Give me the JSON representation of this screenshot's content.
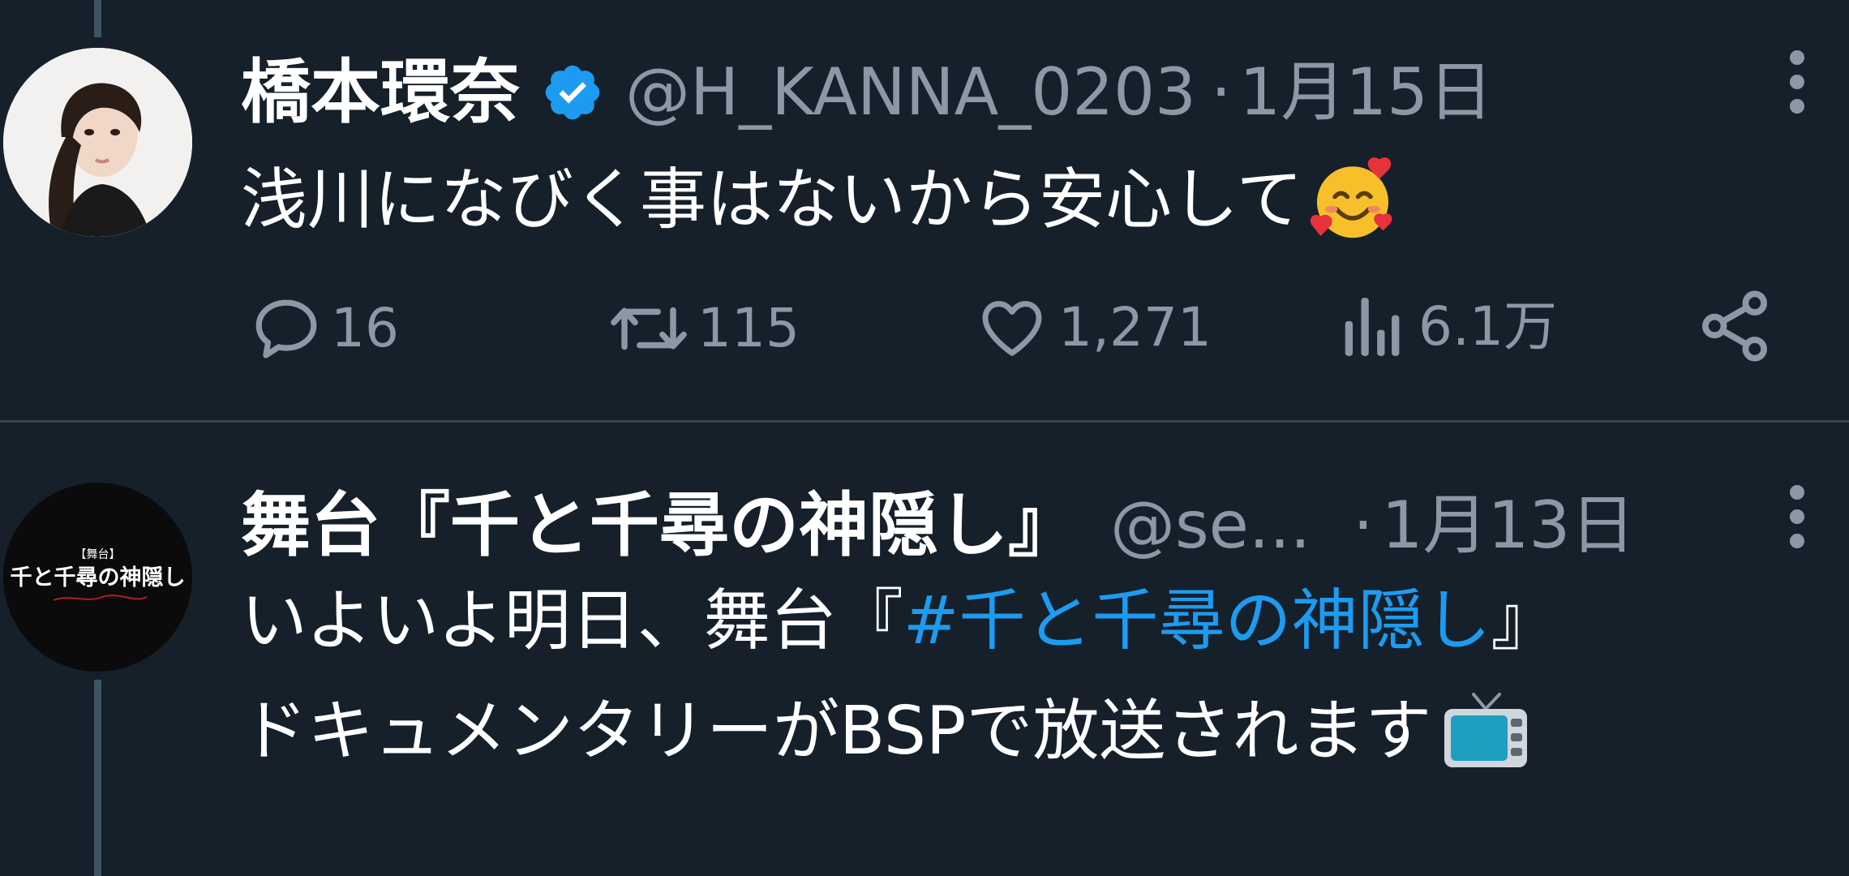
{
  "tweets": [
    {
      "name": "橋本環奈",
      "verified": true,
      "handle": "@H_KANNA_0203",
      "separator": "·",
      "date": "1月15日",
      "text": "浅川になびく事はないから安心して",
      "emoji": "smiling-face-with-hearts",
      "actions": {
        "replies": "16",
        "retweets": "115",
        "likes": "1,271",
        "views": "6.1万"
      }
    },
    {
      "name": "舞台『千と千尋の神隠し』",
      "handle": "@se...",
      "separator": "·",
      "date": "1月13日",
      "avatar_text": "千と千尋の神隠し",
      "avatar_small": "【舞台】",
      "text_line1_prefix": "いよいよ明日、舞台『",
      "hashtag": "#千と千尋の神隠し",
      "text_line1_suffix": "』",
      "text_line2": "ドキュメンタリーがBSPで放送されます",
      "emoji": "television"
    }
  ],
  "colors": {
    "background": "#15202b",
    "text": "#ffffff",
    "muted": "#8b98a5",
    "accent": "#1d9bf0",
    "divider": "#38444d",
    "thread": "#3d5466"
  }
}
